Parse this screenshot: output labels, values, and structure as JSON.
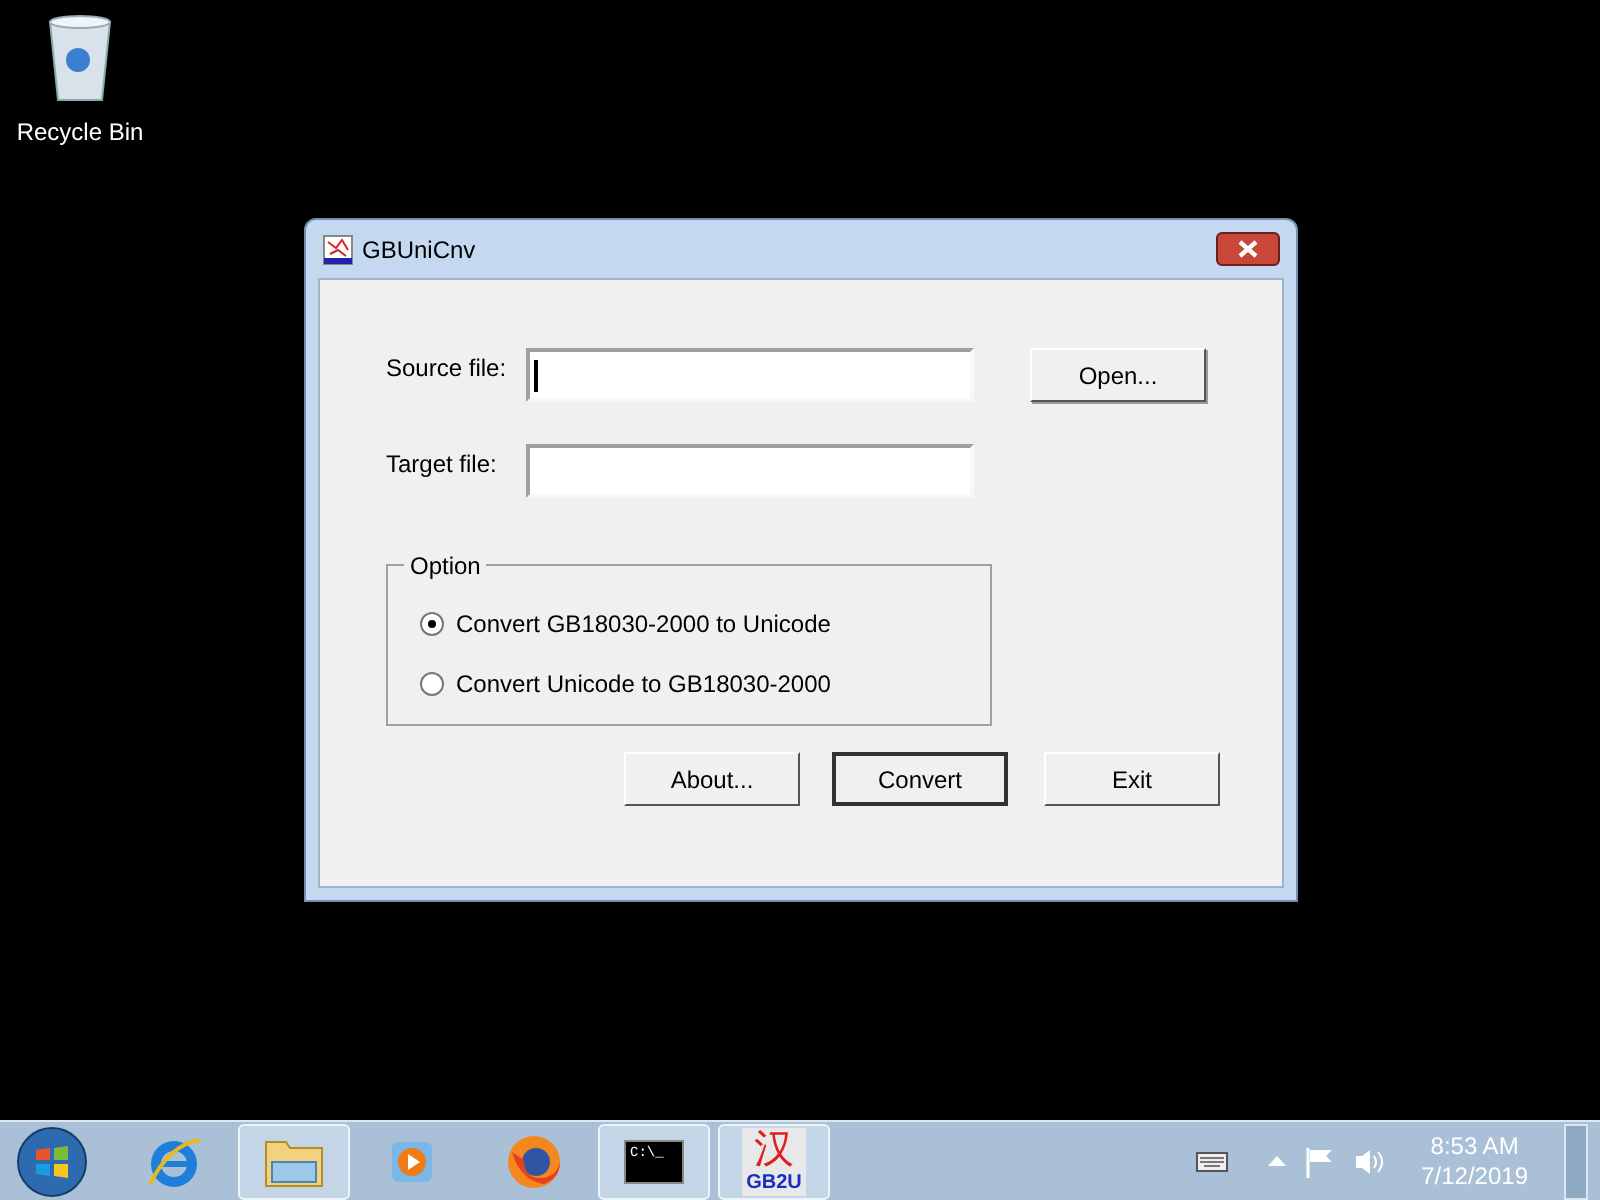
{
  "desktop_icons": [
    {
      "label": "Recycle Bin"
    }
  ],
  "window": {
    "title": "GBUniCnv"
  },
  "form": {
    "fields": [
      {
        "label": "Source file:",
        "focused": true
      },
      {
        "label": "Target file:",
        "focused": false
      }
    ],
    "open_button": "Open...",
    "option_group": {
      "legend": "Option",
      "radios": [
        {
          "label": "Convert GB18030-2000 to Unicode",
          "selected": true
        },
        {
          "label": "Convert Unicode to GB18030-2000",
          "selected": false
        }
      ]
    },
    "buttons": [
      {
        "label": "About...",
        "default": false
      },
      {
        "label": "Convert",
        "default": true
      },
      {
        "label": "Exit",
        "default": false
      }
    ]
  },
  "taskbar": {
    "apps": [
      {
        "kind": "ie",
        "open": false
      },
      {
        "kind": "explorer",
        "open": true
      },
      {
        "kind": "media",
        "open": false
      },
      {
        "kind": "firefox",
        "open": false
      },
      {
        "kind": "cmd",
        "open": true,
        "glyph": "C:\\_"
      },
      {
        "kind": "gb2u",
        "open": true,
        "glyph": "汉",
        "label": "GB2U"
      }
    ],
    "time": "8:53 AM",
    "date": "7/12/2019"
  }
}
